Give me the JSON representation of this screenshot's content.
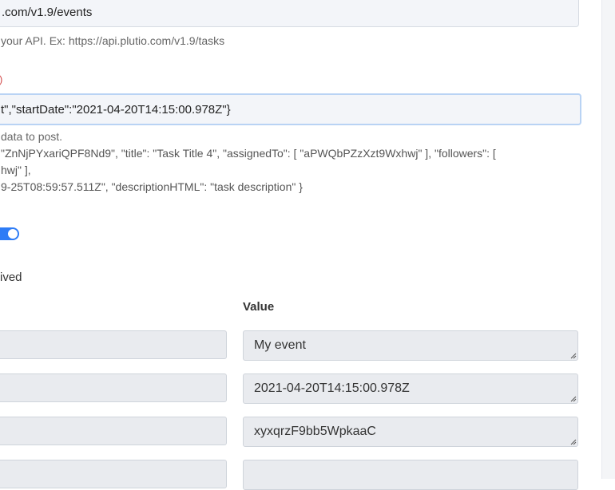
{
  "url_field": {
    "value": ".com/v1.9/events"
  },
  "url_help": "your API. Ex: https://api.plutio.com/v1.9/tasks",
  "required_mark": ")",
  "body_field": {
    "value": "t\",\"startDate\":\"2021-04-20T14:15:00.978Z\"}"
  },
  "body_help": [
    "data to post.",
    "\"ZnNjPYxariQPF8Nd9\", \"title\": \"Task Title 4\", \"assignedTo\": [ \"aPWQbPZzXzt9Wxhwj\" ], \"followers\": [",
    "hwj\" ],",
    "9-25T08:59:57.511Z\", \"descriptionHTML\": \"task description\" }"
  ],
  "switch_label": "ived",
  "value_column_header": "Value",
  "rows": [
    {
      "value": "My event"
    },
    {
      "value": "2021-04-20T14:15:00.978Z"
    },
    {
      "value": "xyxqrzF9bb5WpkaaC"
    },
    {
      "value": ""
    }
  ],
  "colors": {
    "accent": "#2e7cf6",
    "field_bg": "#e9ebef",
    "required": "#d24b4b"
  }
}
